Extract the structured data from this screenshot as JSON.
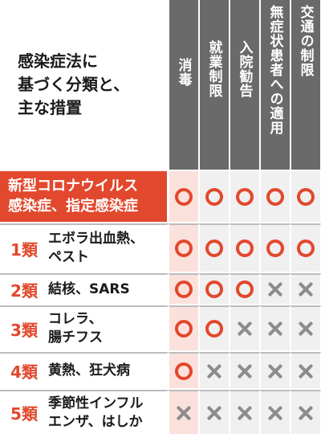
{
  "title": "感染症法に\n基づく分類と、\n主な措置",
  "columns": [
    {
      "label": "消毒"
    },
    {
      "label": "就業制限"
    },
    {
      "label": "入院勧告"
    },
    {
      "label": "無症状患者への適用"
    },
    {
      "label": "交通の制限"
    }
  ],
  "rows": [
    {
      "class": "",
      "name": "新型コロナウイルス\n感染症、指定感染症",
      "marks": [
        "circle",
        "circle",
        "circle",
        "circle",
        "circle"
      ]
    },
    {
      "class": "1類",
      "name": "エボラ出血熱、\nペスト",
      "marks": [
        "circle",
        "circle",
        "circle",
        "circle",
        "circle"
      ]
    },
    {
      "class": "2類",
      "name": "結核、SARS",
      "marks": [
        "circle",
        "circle",
        "circle",
        "cross",
        "cross"
      ]
    },
    {
      "class": "3類",
      "name": "コレラ、\n腸チフス",
      "marks": [
        "circle",
        "circle",
        "cross",
        "cross",
        "cross"
      ]
    },
    {
      "class": "4類",
      "name": "黄熱、狂犬病",
      "marks": [
        "circle",
        "cross",
        "cross",
        "cross",
        "cross"
      ]
    },
    {
      "class": "5類",
      "name": "季節性インフル\nエンザ、はしか",
      "marks": [
        "cross",
        "cross",
        "cross",
        "cross",
        "cross"
      ]
    }
  ],
  "colors": {
    "accent": "#e2482d",
    "header": "#6a6a6a",
    "cross": "#8c8c8c",
    "pink": "#fbe1dc"
  }
}
